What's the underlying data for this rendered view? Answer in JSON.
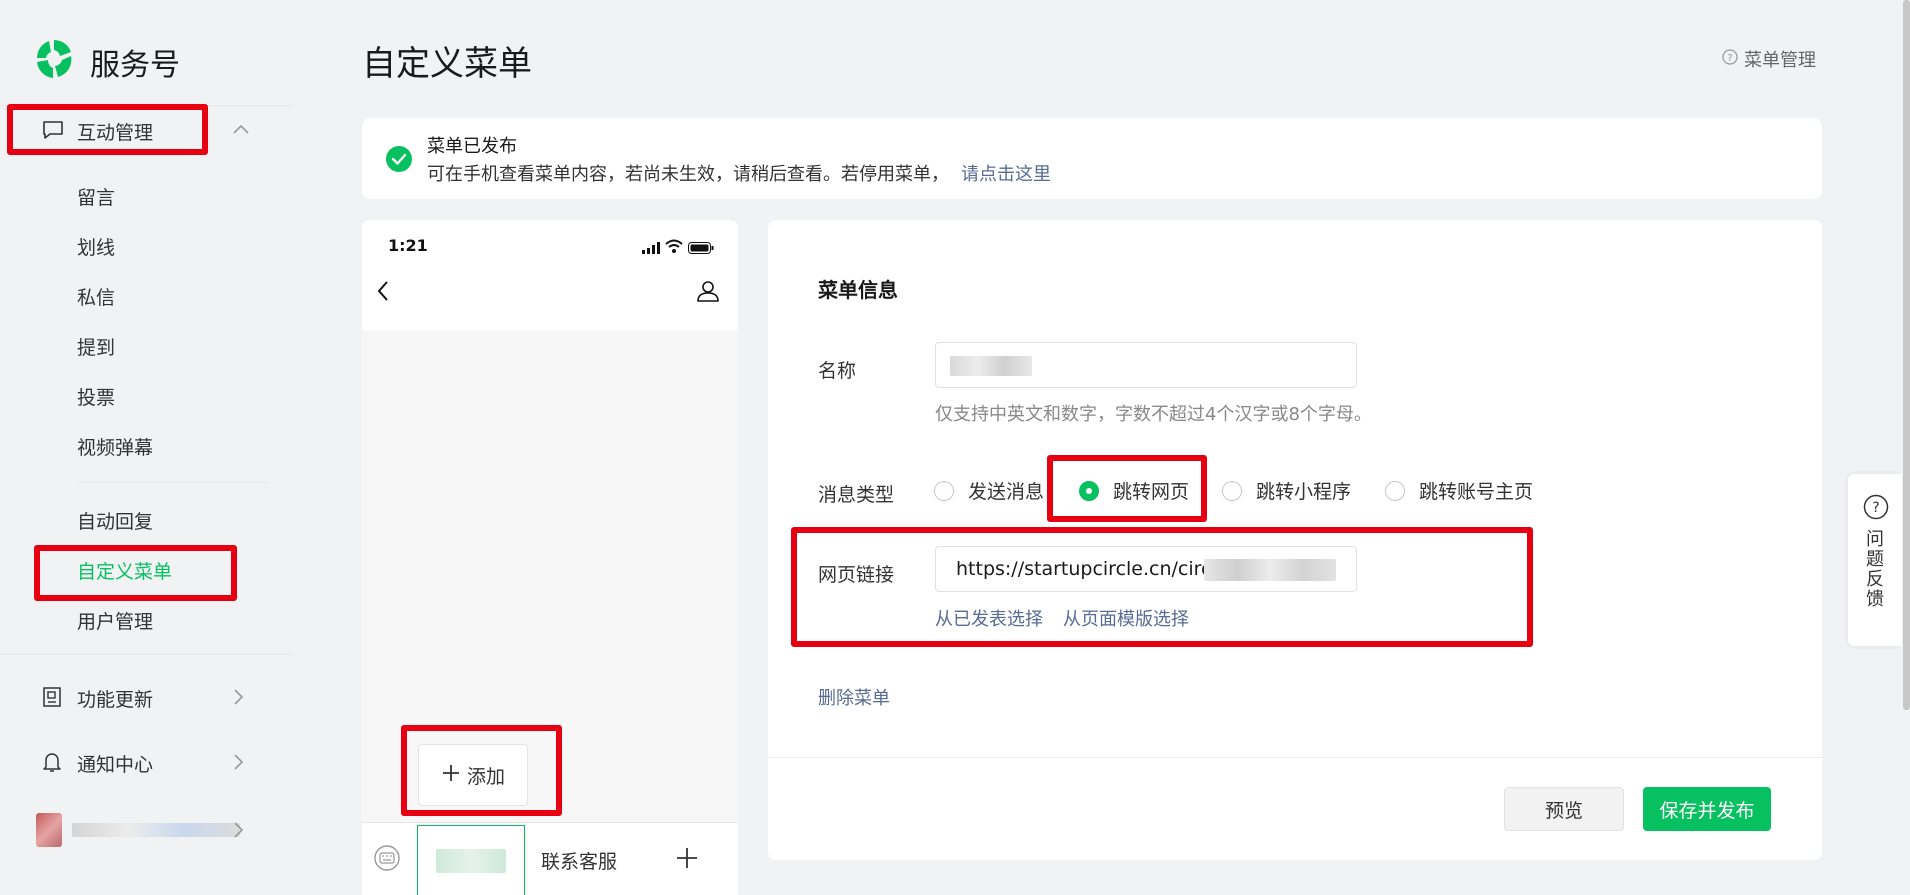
{
  "brand": {
    "name": "服务号",
    "icon": "wechat-service-logo",
    "accent": "#07c160"
  },
  "sidebar": {
    "group": {
      "label": "互动管理",
      "icon": "message-square-icon",
      "expanded": true
    },
    "items": [
      {
        "label": "留言"
      },
      {
        "label": "划线"
      },
      {
        "label": "私信"
      },
      {
        "label": "提到"
      },
      {
        "label": "投票"
      },
      {
        "label": "视频弹幕"
      },
      {
        "label": "自动回复"
      },
      {
        "label": "自定义菜单",
        "active": true
      },
      {
        "label": "用户管理"
      }
    ],
    "bottom": [
      {
        "label": "功能更新",
        "icon": "book-icon"
      },
      {
        "label": "通知中心",
        "icon": "bell-icon"
      }
    ]
  },
  "header": {
    "title": "自定义菜单",
    "help": "菜单管理"
  },
  "notice": {
    "title": "菜单已发布",
    "desc": "可在手机查看菜单内容，若尚未生效，请稍后查看。若停用菜单，",
    "link": "请点击这里"
  },
  "phone": {
    "time": "1:21",
    "add_label": "添加",
    "tabs": [
      "联系客服"
    ]
  },
  "form": {
    "section_title": "菜单信息",
    "name_label": "名称",
    "name_hint": "仅支持中英文和数字，字数不超过4个汉字或8个字母。",
    "type_label": "消息类型",
    "types": [
      {
        "label": "发送消息",
        "checked": false
      },
      {
        "label": "跳转网页",
        "checked": true
      },
      {
        "label": "跳转小程序",
        "checked": false
      },
      {
        "label": "跳转账号主页",
        "checked": false
      }
    ],
    "url_label": "网页链接",
    "url_value": "https://startupcircle.cn/circle/",
    "select_published": "从已发表选择",
    "select_template": "从页面模版选择",
    "delete_label": "删除菜单"
  },
  "actions": {
    "preview": "预览",
    "publish": "保存并发布"
  },
  "feedback": {
    "label": "问题反馈"
  }
}
